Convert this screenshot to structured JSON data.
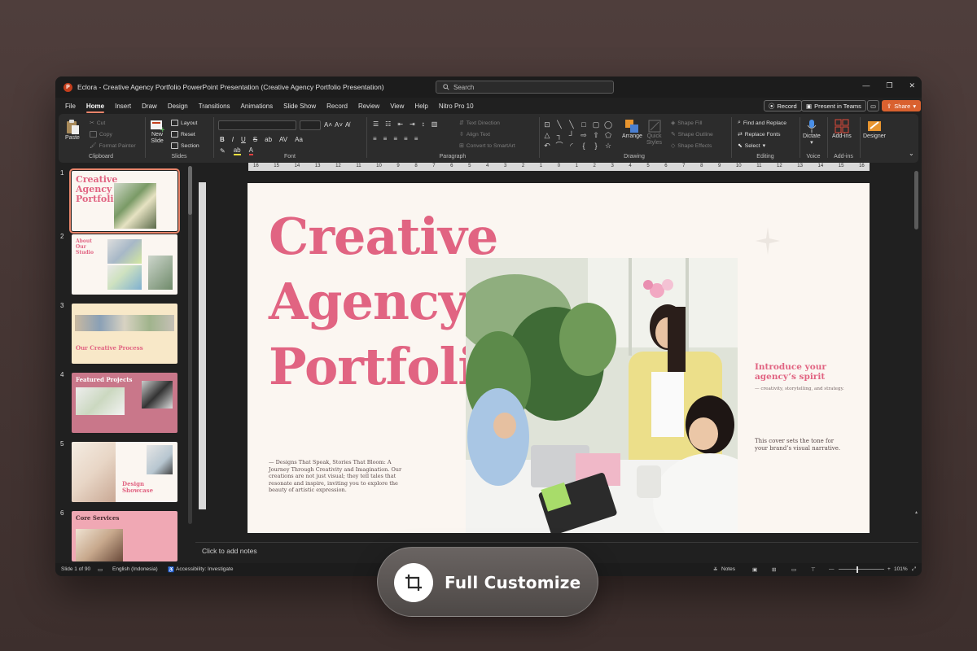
{
  "window": {
    "title": "Eclora - Creative Agency Portfolio PowerPoint Presentation (Creative Agency Portfolio Presentation)",
    "search_placeholder": "Search",
    "minimize": "—",
    "restore": "❐",
    "close": "✕"
  },
  "menu": {
    "tabs": [
      "File",
      "Home",
      "Insert",
      "Draw",
      "Design",
      "Transitions",
      "Animations",
      "Slide Show",
      "Record",
      "Review",
      "View",
      "Help",
      "Nitro Pro 10"
    ],
    "active": "Home",
    "record": "Record",
    "present_teams": "Present in Teams",
    "share": "Share"
  },
  "ribbon": {
    "clipboard": {
      "label": "Clipboard",
      "paste": "Paste",
      "cut": "Cut",
      "copy": "Copy",
      "format_painter": "Format Painter"
    },
    "slides": {
      "label": "Slides",
      "new_slide_1": "New",
      "new_slide_2": "Slide",
      "layout": "Layout",
      "reset": "Reset",
      "section": "Section"
    },
    "font": {
      "label": "Font",
      "bold": "B",
      "italic": "I",
      "underline": "U",
      "strike": "S",
      "shadow": "ab",
      "spacing": "AV",
      "case": "Aa"
    },
    "paragraph": {
      "label": "Paragraph",
      "text_direction": "Text Direction",
      "align_text": "Align Text",
      "convert_smartart": "Convert to SmartArt"
    },
    "drawing": {
      "label": "Drawing",
      "arrange": "Arrange",
      "quick_styles_1": "Quick",
      "quick_styles_2": "Styles",
      "shape_fill": "Shape Fill",
      "shape_outline": "Shape Outline",
      "shape_effects": "Shape Effects"
    },
    "editing": {
      "label": "Editing",
      "find_replace": "Find and Replace",
      "replace_fonts": "Replace Fonts",
      "select": "Select"
    },
    "voice": {
      "label": "Voice",
      "dictate": "Dictate"
    },
    "addins": {
      "label": "Add-ins",
      "addins": "Add-ins"
    },
    "designer": {
      "designer": "Designer"
    }
  },
  "thumbnails": [
    {
      "num": "1",
      "title": "Creative Agency Portfolio"
    },
    {
      "num": "2",
      "title": "About Our Studio"
    },
    {
      "num": "3",
      "title": "Our Creative Process"
    },
    {
      "num": "4",
      "title": "Featured Projects"
    },
    {
      "num": "5",
      "title": "Design Showcase"
    },
    {
      "num": "6",
      "title": "Core Services"
    }
  ],
  "ruler_ticks": [
    "16",
    "15",
    "14",
    "13",
    "12",
    "11",
    "10",
    "9",
    "8",
    "7",
    "6",
    "5",
    "4",
    "3",
    "2",
    "1",
    "0",
    "1",
    "2",
    "3",
    "4",
    "5",
    "6",
    "7",
    "8",
    "9",
    "10",
    "11",
    "12",
    "13",
    "14",
    "15",
    "16"
  ],
  "slide": {
    "title_lines": [
      "Creative",
      "Agency",
      "Portfolio"
    ],
    "description": "— Designs That Speak, Stories That Bloom: A Journey Through Creativity and Imagination. Our creations are not just visual; they tell tales that resonate and inspire, inviting you to explore the beauty of artistic expression.",
    "intro_line1": "Introduce your",
    "intro_line2": "agency’s spirit",
    "intro_sub": "— creativity, storytelling, and strategy.",
    "cover_line1": "This cover sets the tone for",
    "cover_line2": "your brand’s visual narrative.",
    "accent": "#e16482"
  },
  "notes_placeholder": "Click to add notes",
  "status": {
    "slide_of": "Slide 1 of 90",
    "language": "English (Indonesia)",
    "accessibility": "Accessibility: Investigate",
    "notes": "Notes",
    "zoom": "101%"
  },
  "badge": {
    "label": "Full Customize"
  }
}
